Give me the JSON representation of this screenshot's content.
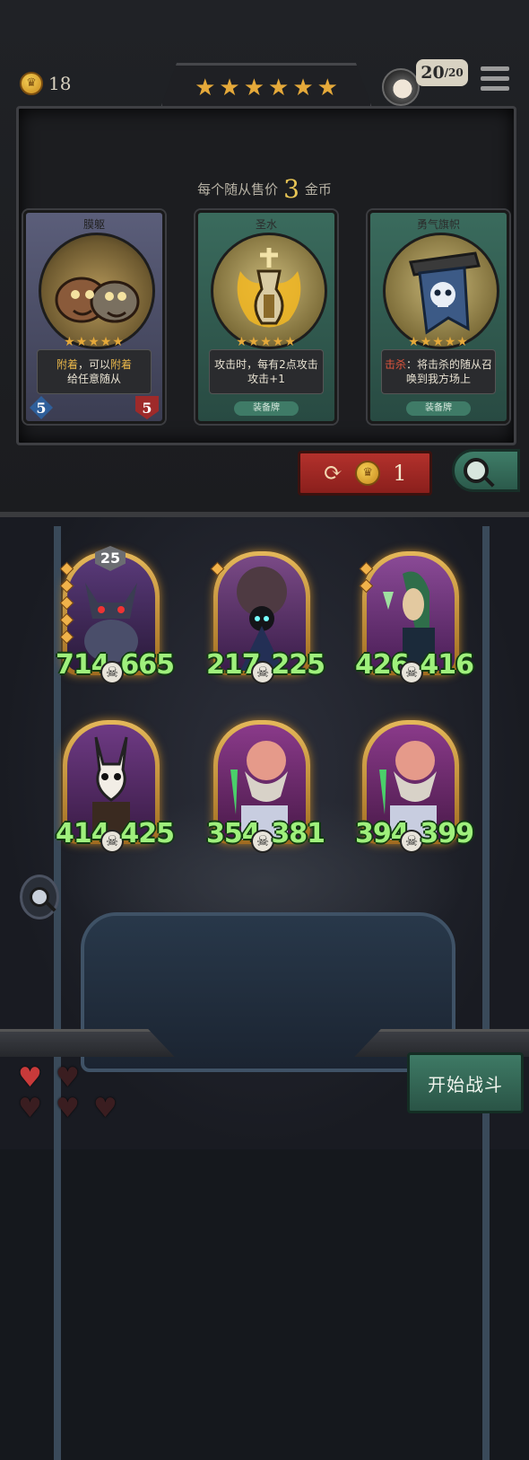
{
  "top_bar": {
    "gold": "18",
    "tier_stars": [
      "★",
      "★",
      "★",
      "★",
      "★",
      "★"
    ],
    "hp_current": "20",
    "hp_max": "/20",
    "menu_icon": "hamburger-menu-icon"
  },
  "shop": {
    "price_prefix": "每个随从售价",
    "price_value": "3",
    "price_suffix": "金币",
    "cards": [
      {
        "title": "膜躯",
        "type": "minion",
        "stars": "★★★★★",
        "desc_keyword_1": "附着",
        "desc_mid": "，可以",
        "desc_keyword_2": "附着",
        "desc_tail": "给任意随从",
        "attack": "5",
        "health": "5"
      },
      {
        "title": "圣水",
        "type": "equipment",
        "stars": "★★★★★",
        "desc": "攻击时，每有2点攻击攻击+1",
        "footer": "装备牌"
      },
      {
        "title": "勇气旗帜",
        "type": "equipment",
        "stars": "★★★★★",
        "desc_keyword": "击杀",
        "desc": "：将击杀的随从召唤到我方场上",
        "footer": "装备牌"
      }
    ],
    "refresh_cost": "1"
  },
  "board": {
    "units": [
      {
        "name": "horned-demon",
        "attack": "714",
        "health": "665",
        "level": "25",
        "upgrades": 5
      },
      {
        "name": "hooded-mage",
        "attack": "217",
        "health": "225",
        "upgrades": 1
      },
      {
        "name": "green-haired-elf",
        "attack": "426",
        "health": "416",
        "upgrades": 2
      },
      {
        "name": "masked-rabbit",
        "attack": "414",
        "health": "425"
      },
      {
        "name": "bearded-dwarf",
        "attack": "354",
        "health": "381"
      },
      {
        "name": "bearded-dwarf",
        "attack": "394",
        "health": "399"
      }
    ],
    "lives": {
      "full": 1,
      "empty": 4
    },
    "fight_button": "开始战斗"
  }
}
